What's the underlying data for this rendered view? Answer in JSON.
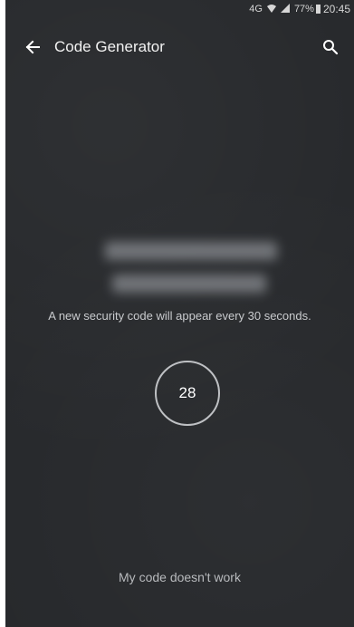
{
  "status_bar": {
    "signal_text": "4G",
    "battery_percent": "77%",
    "time": "20:45"
  },
  "header": {
    "title": "Code Generator"
  },
  "main": {
    "info_text": "A new security code will appear every 30 seconds.",
    "timer_value": "28",
    "help_link": "My code doesn't work"
  }
}
